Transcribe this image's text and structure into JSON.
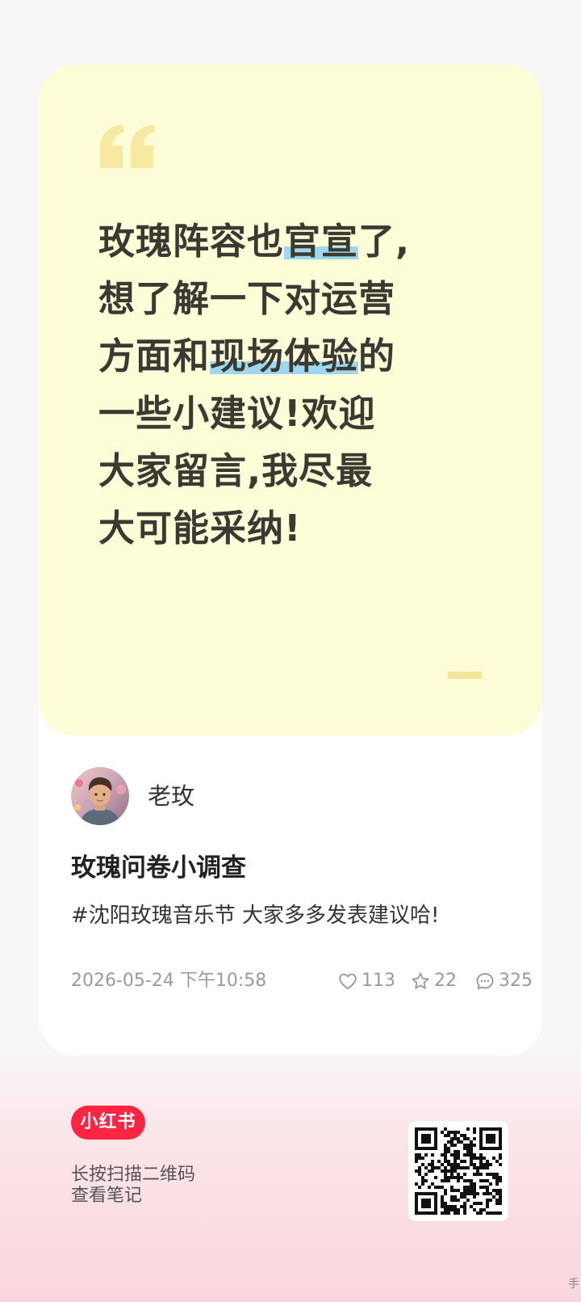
{
  "quote": {
    "lines": [
      {
        "segments": [
          {
            "text": "玫瑰阵容也",
            "hl": false
          },
          {
            "text": "官宣",
            "hl": true
          },
          {
            "text": "了,",
            "hl": false
          }
        ]
      },
      {
        "segments": [
          {
            "text": "想了解一下对运营",
            "hl": false
          }
        ]
      },
      {
        "segments": [
          {
            "text": "方面和",
            "hl": false
          },
          {
            "text": "现场体验",
            "hl": true
          },
          {
            "text": "的",
            "hl": false
          }
        ]
      },
      {
        "segments": [
          {
            "text": "一些小建议!欢迎",
            "hl": false
          }
        ]
      },
      {
        "segments": [
          {
            "text": "大家留言,我尽最",
            "hl": false
          }
        ]
      },
      {
        "segments": [
          {
            "text": "大可能采纳!",
            "hl": false
          }
        ]
      }
    ],
    "quote_mark_color": "#f7e9a2",
    "highlight_color": "#9fd6f0",
    "panel_color": "#fdfdd7"
  },
  "author": {
    "name": "老玫",
    "avatar_icon": "avatar-icon"
  },
  "note": {
    "title": "玫瑰问卷小调查",
    "body": "#沈阳玫瑰音乐节 大家多多发表建议哈!",
    "date": "2026-05-24 下午10:58",
    "likes": "113",
    "collects": "22",
    "comments": "325"
  },
  "footer": {
    "logo_text": "小红书",
    "hint_line1": "长按扫描二维码",
    "hint_line2": "查看笔记",
    "brand_color": "#ff2442",
    "corner_glyph": "手"
  }
}
